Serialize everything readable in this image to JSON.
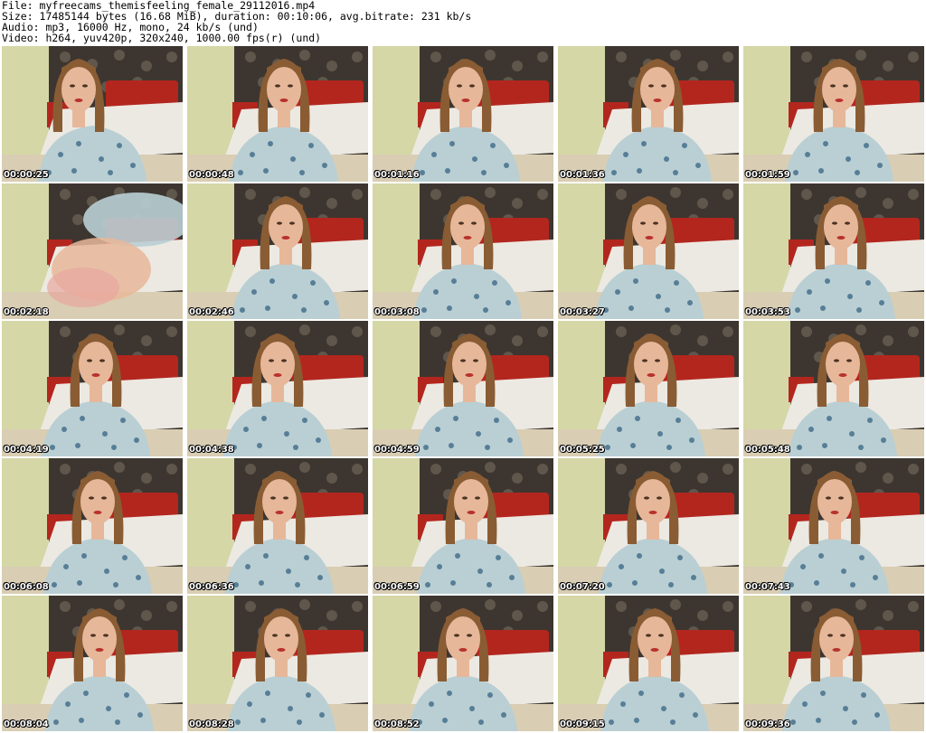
{
  "header": {
    "file_line": "File: myfreecams_themisfeeling_female_29112016.mp4",
    "size_line": "Size: 17485144 bytes (16.68 MiB), duration: 00:10:06, avg.bitrate: 231 kb/s",
    "audio_line": "Audio: mp3, 16000 Hz, mono, 24 kb/s (und)",
    "video_line": "Video: h264, yuv420p, 320x240, 1000.00 fps(r) (und)"
  },
  "thumbnails": [
    {
      "timestamp": "00:00:25"
    },
    {
      "timestamp": "00:00:48"
    },
    {
      "timestamp": "00:01:16"
    },
    {
      "timestamp": "00:01:36"
    },
    {
      "timestamp": "00:01:59"
    },
    {
      "timestamp": "00:02:18"
    },
    {
      "timestamp": "00:02:46"
    },
    {
      "timestamp": "00:03:08"
    },
    {
      "timestamp": "00:03:27"
    },
    {
      "timestamp": "00:03:53"
    },
    {
      "timestamp": "00:04:19"
    },
    {
      "timestamp": "00:04:38"
    },
    {
      "timestamp": "00:04:59"
    },
    {
      "timestamp": "00:05:25"
    },
    {
      "timestamp": "00:05:48"
    },
    {
      "timestamp": "00:06:08"
    },
    {
      "timestamp": "00:06:36"
    },
    {
      "timestamp": "00:06:59"
    },
    {
      "timestamp": "00:07:20"
    },
    {
      "timestamp": "00:07:43"
    },
    {
      "timestamp": "00:08:04"
    },
    {
      "timestamp": "00:08:28"
    },
    {
      "timestamp": "00:08:52"
    },
    {
      "timestamp": "00:09:15"
    },
    {
      "timestamp": "00:09:36"
    }
  ],
  "colors": {
    "wall": "#c9cc9a",
    "wallpaper_dark": "#3d3630",
    "headboard": "#b3261e",
    "bedsheet": "#ece9e2",
    "hair": "#8a5c34",
    "skin": "#e7b79a",
    "blouse": "#b9cfd4",
    "blouse_dots": "#2f5d7c",
    "floor": "#d9cdb3"
  }
}
